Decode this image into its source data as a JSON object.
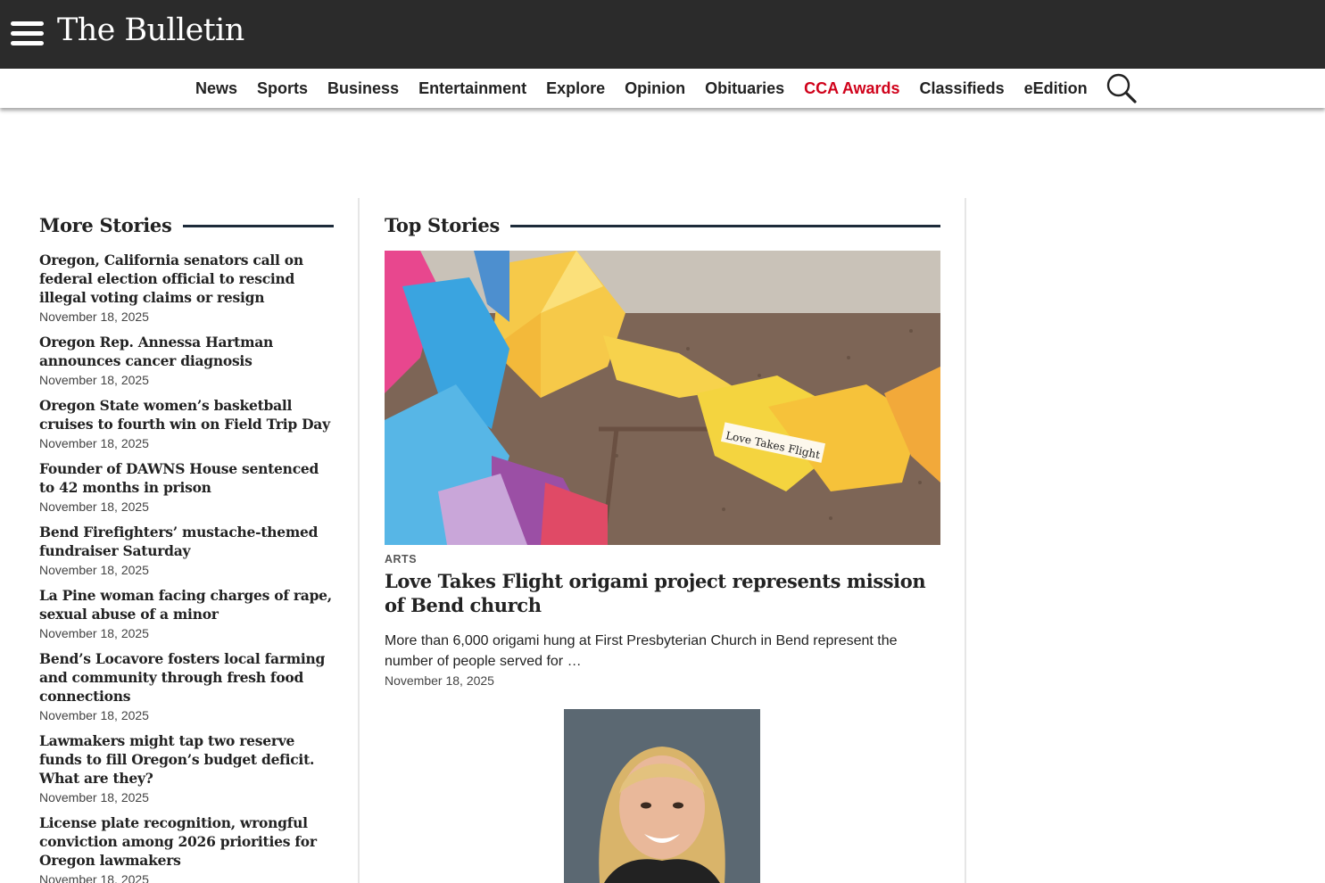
{
  "header": {
    "logo_text": "The Bulletin",
    "menu_icon": "hamburger-menu-icon",
    "colors": {
      "topbar": "#2b2b2b",
      "accent": "#d0021b"
    }
  },
  "nav": {
    "items": [
      "News",
      "Sports",
      "Business",
      "Entertainment",
      "Explore",
      "Opinion",
      "Obituaries",
      "CCA Awards",
      "Classifieds",
      "eEdition"
    ],
    "highlighted": "CCA Awards",
    "search_icon": "search-icon"
  },
  "more_stories": {
    "heading": "More Stories",
    "items": [
      {
        "title": "Oregon, California senators call on federal election official to rescind illegal voting claims or resign",
        "date": "November 18, 2025"
      },
      {
        "title": "Oregon Rep. Annessa Hartman announces cancer diagnosis",
        "date": "November 18, 2025"
      },
      {
        "title": "Oregon State women’s basketball cruises to fourth win on Field Trip Day",
        "date": "November 18, 2025"
      },
      {
        "title": "Founder of DAWNS House sentenced to 42 months in prison",
        "date": "November 18, 2025"
      },
      {
        "title": "Bend Firefighters’ mustache-themed fundraiser Saturday",
        "date": "November 18, 2025"
      },
      {
        "title": "La Pine woman facing charges of rape, sexual abuse of a minor",
        "date": "November 18, 2025"
      },
      {
        "title": "Bend’s Locavore fosters local farming and community through fresh food connections",
        "date": "November 18, 2025"
      },
      {
        "title": "Lawmakers might tap two reserve funds to fill Oregon’s budget deficit. What are they?",
        "date": "November 18, 2025"
      },
      {
        "title": "License plate recognition, wrongful conviction among 2026 priorities for Oregon lawmakers",
        "date": "November 18, 2025"
      }
    ]
  },
  "top_stories": {
    "heading": "Top Stories",
    "lead": {
      "kicker": "ARTS",
      "title": "Love Takes Flight origami project represents mission of Bend church",
      "summary": "More than 6,000 origami hung at First Presbyterian Church in Bend represent the number of people served for …",
      "date": "November 18, 2025",
      "image_label": "Love Takes Flight"
    }
  }
}
